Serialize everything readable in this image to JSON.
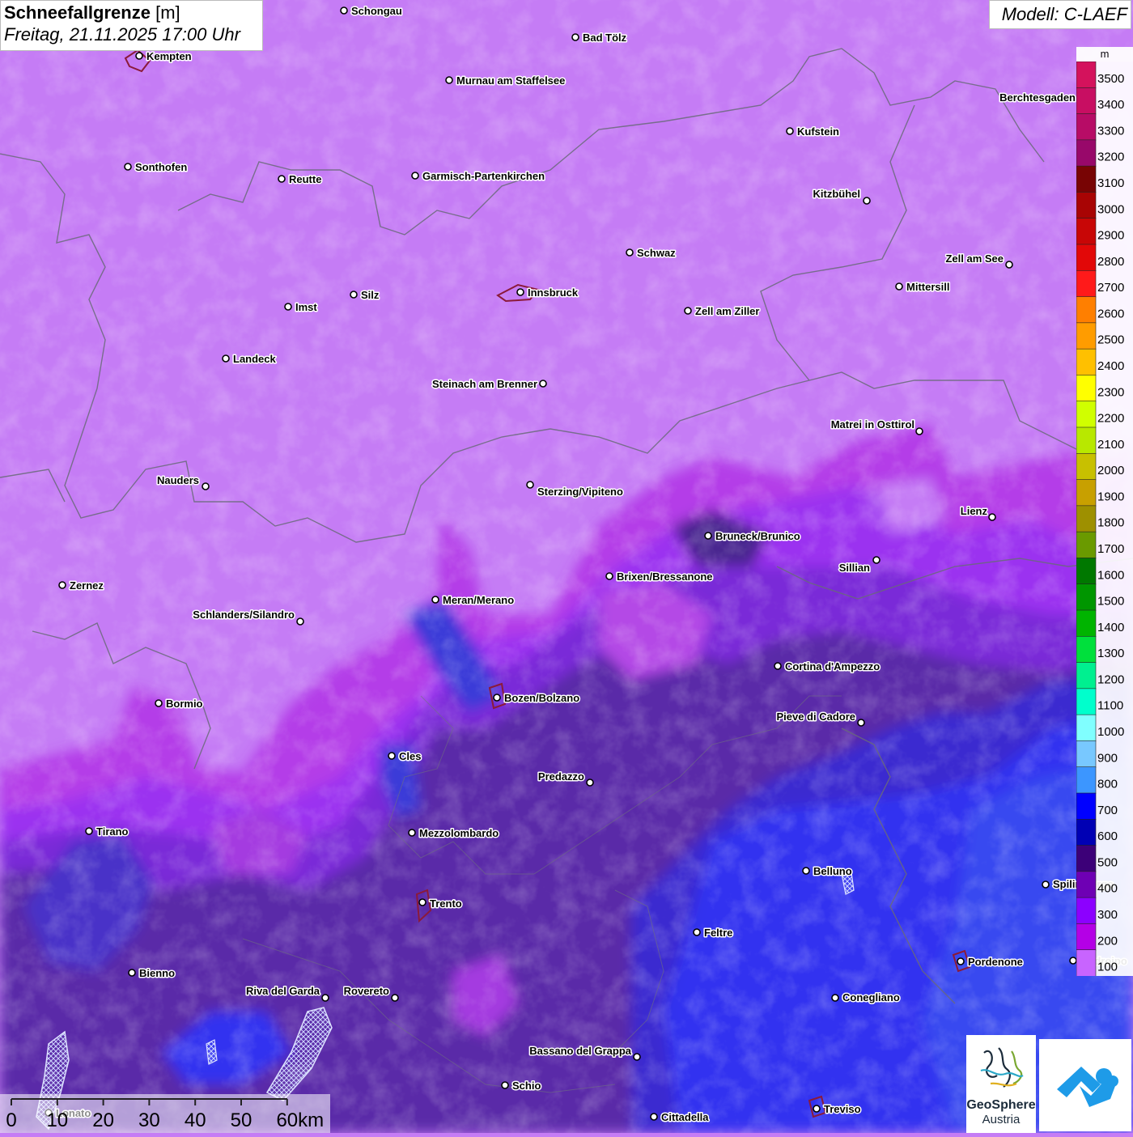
{
  "header": {
    "title": "Schneefallgrenze",
    "unit": "[m]",
    "datetime": "Freitag, 21.11.2025 17:00 Uhr",
    "model": "Modell: C-LAEF"
  },
  "legend": {
    "unit": "m",
    "entries": [
      {
        "value": "3500",
        "color": "#d4125c"
      },
      {
        "value": "3400",
        "color": "#c80e62"
      },
      {
        "value": "3300",
        "color": "#b70c66"
      },
      {
        "value": "3200",
        "color": "#98086a"
      },
      {
        "value": "3100",
        "color": "#780404"
      },
      {
        "value": "3000",
        "color": "#a80404"
      },
      {
        "value": "2900",
        "color": "#c80606"
      },
      {
        "value": "2800",
        "color": "#e20808"
      },
      {
        "value": "2700",
        "color": "#ff1a1a"
      },
      {
        "value": "2600",
        "color": "#ff7f00"
      },
      {
        "value": "2500",
        "color": "#ff9c00"
      },
      {
        "value": "2400",
        "color": "#ffc000"
      },
      {
        "value": "2300",
        "color": "#ffff00"
      },
      {
        "value": "2200",
        "color": "#d0ff00"
      },
      {
        "value": "2100",
        "color": "#b8e800"
      },
      {
        "value": "2000",
        "color": "#c8c000"
      },
      {
        "value": "1900",
        "color": "#c8a000"
      },
      {
        "value": "1800",
        "color": "#9e9000"
      },
      {
        "value": "1700",
        "color": "#6a9a00"
      },
      {
        "value": "1600",
        "color": "#007800"
      },
      {
        "value": "1500",
        "color": "#009600"
      },
      {
        "value": "1400",
        "color": "#00b400"
      },
      {
        "value": "1300",
        "color": "#00e03c"
      },
      {
        "value": "1200",
        "color": "#00f090"
      },
      {
        "value": "1100",
        "color": "#00ffcc"
      },
      {
        "value": "1000",
        "color": "#80ffff"
      },
      {
        "value": "900",
        "color": "#78c8ff"
      },
      {
        "value": "800",
        "color": "#3c96ff"
      },
      {
        "value": "700",
        "color": "#0000ff"
      },
      {
        "value": "600",
        "color": "#0000b4"
      },
      {
        "value": "500",
        "color": "#3c0078"
      },
      {
        "value": "400",
        "color": "#6e00b4"
      },
      {
        "value": "300",
        "color": "#8c00ff"
      },
      {
        "value": "200",
        "color": "#b400e6"
      },
      {
        "value": "100",
        "color": "#c864ff"
      }
    ]
  },
  "cities": [
    {
      "name": "Schongau"
    },
    {
      "name": "Bad Tölz"
    },
    {
      "name": "Kempten"
    },
    {
      "name": "Murnau am Staffelsee"
    },
    {
      "name": "Berchtesgaden"
    },
    {
      "name": "Kufstein"
    },
    {
      "name": "Sonthofen"
    },
    {
      "name": "Reutte"
    },
    {
      "name": "Garmisch-Partenkirchen"
    },
    {
      "name": "Kitzbühel"
    },
    {
      "name": "Schwaz"
    },
    {
      "name": "Zell am See"
    },
    {
      "name": "Mittersill"
    },
    {
      "name": "Innsbruck"
    },
    {
      "name": "Imst"
    },
    {
      "name": "Silz"
    },
    {
      "name": "Zell am Ziller"
    },
    {
      "name": "Landeck"
    },
    {
      "name": "Steinach am Brenner"
    },
    {
      "name": "Matrei in Osttirol"
    },
    {
      "name": "Nauders"
    },
    {
      "name": "Sterzing/Vipiteno"
    },
    {
      "name": "Lienz"
    },
    {
      "name": "Bruneck/Brunico"
    },
    {
      "name": "Sillian"
    },
    {
      "name": "Zernez"
    },
    {
      "name": "Brixen/Bressanone"
    },
    {
      "name": "Meran/Merano"
    },
    {
      "name": "Schlanders/Silandro"
    },
    {
      "name": "Cortina d'Ampezzo"
    },
    {
      "name": "Bozen/Bolzano"
    },
    {
      "name": "Bormio"
    },
    {
      "name": "Pieve di Cadore"
    },
    {
      "name": "Cles"
    },
    {
      "name": "Predazzo"
    },
    {
      "name": "Tirano"
    },
    {
      "name": "Mezzolombardo"
    },
    {
      "name": "Belluno"
    },
    {
      "name": "Spilimbergo"
    },
    {
      "name": "Trento"
    },
    {
      "name": "Feltre"
    },
    {
      "name": "Pordenone"
    },
    {
      "name": "Codroipo"
    },
    {
      "name": "Bienno"
    },
    {
      "name": "Riva del Garda"
    },
    {
      "name": "Rovereto"
    },
    {
      "name": "Conegliano"
    },
    {
      "name": "Bassano del Grappa"
    },
    {
      "name": "Schio"
    },
    {
      "name": "Treviso"
    },
    {
      "name": "Cittadella"
    },
    {
      "name": "Lonato"
    }
  ],
  "scalebar": {
    "labels": [
      "0",
      "10",
      "20",
      "30",
      "40",
      "50",
      "60km"
    ]
  },
  "logos": {
    "geosphere_name": "GeoSphere",
    "geosphere_sub": "Austria"
  }
}
